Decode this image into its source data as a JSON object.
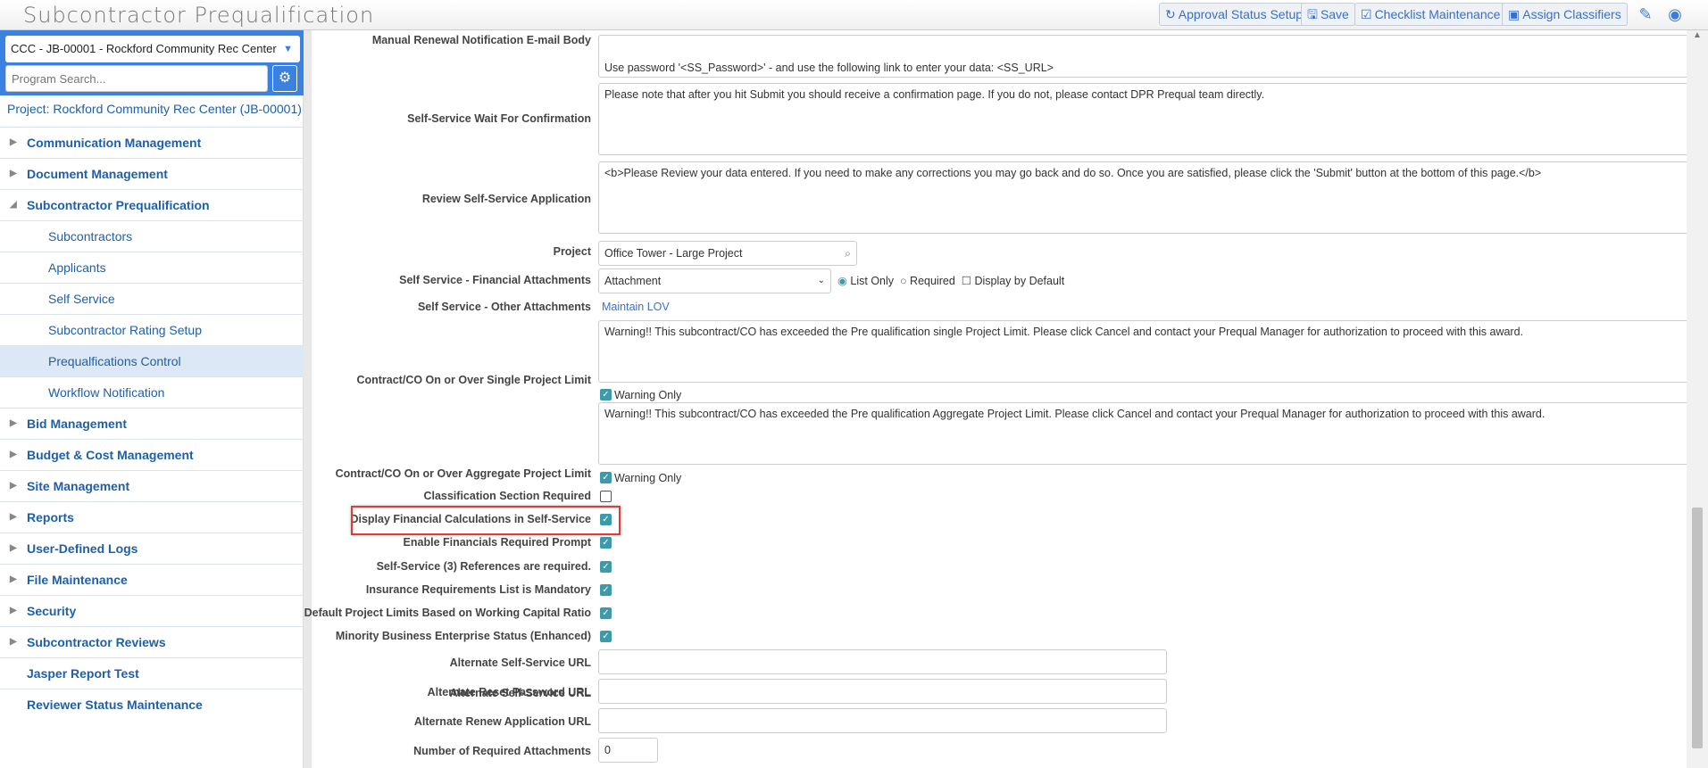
{
  "header": {
    "title": "Subcontractor Prequalification",
    "buttons": {
      "approval": "Approval Status Setup",
      "save": "Save",
      "checklist": "Checklist Maintenance",
      "classifiers": "Assign Classifiers"
    }
  },
  "sidebar": {
    "project_select": "CCC - JB-00001 - Rockford Community Rec Center",
    "search_placeholder": "Program Search...",
    "project_link": "Project: Rockford Community Rec Center (JB-00001)",
    "items": [
      {
        "label": "Communication Management",
        "type": "top"
      },
      {
        "label": "Document Management",
        "type": "top"
      },
      {
        "label": "Subcontractor Prequalification",
        "type": "open"
      },
      {
        "label": "Subcontractors",
        "type": "sub"
      },
      {
        "label": "Applicants",
        "type": "sub"
      },
      {
        "label": "Self Service",
        "type": "sub"
      },
      {
        "label": "Subcontractor Rating Setup",
        "type": "sub"
      },
      {
        "label": "Prequalfications Control",
        "type": "sub",
        "selected": true
      },
      {
        "label": "Workflow Notification",
        "type": "sub"
      },
      {
        "label": "Bid Management",
        "type": "top"
      },
      {
        "label": "Budget & Cost Management",
        "type": "top"
      },
      {
        "label": "Site Management",
        "type": "top"
      },
      {
        "label": "Reports",
        "type": "top"
      },
      {
        "label": "User-Defined Logs",
        "type": "top"
      },
      {
        "label": "File Maintenance",
        "type": "top"
      },
      {
        "label": "Security",
        "type": "top"
      },
      {
        "label": "Subcontractor Reviews",
        "type": "top"
      },
      {
        "label": "Jasper Report Test",
        "type": "plain"
      },
      {
        "label": "Reviewer Status Maintenance",
        "type": "plain"
      }
    ]
  },
  "form": {
    "manual_renewal": {
      "label": "Manual Renewal Notification E-mail Body",
      "value": "Use password '<SS_Password>' - and use the following link to enter your data: <SS_URL>"
    },
    "wait": {
      "label": "Self-Service Wait For Confirmation",
      "value": "Please note that after you hit Submit you should receive a confirmation page.  If you do not, please contact DPR Prequal team directly."
    },
    "review": {
      "label": "Review Self-Service Application",
      "value": "<b>Please Review your data entered.  If you need to make any corrections you may go back and do so.  Once you are satisfied, please click the 'Submit' button at the bottom of this page.</b>"
    },
    "project": {
      "label": "Project",
      "value": "Office Tower - Large Project"
    },
    "fin_attach": {
      "label": "Self Service - Financial Attachments",
      "value": "Attachment",
      "list_only": "List Only",
      "required": "Required",
      "display_default": "Display by Default"
    },
    "other_attach": {
      "label": "Self Service - Other Attachments",
      "link": "Maintain LOV"
    },
    "single_limit": {
      "label": "Contract/CO On or Over Single Project Limit",
      "value": "Warning!! This subcontract/CO has exceeded the Pre qualification single Project Limit. Please click Cancel and contact your Prequal Manager for authorization to proceed with this award.",
      "warning": "Warning Only"
    },
    "aggregate_limit": {
      "label": "Contract/CO On or Over Aggregate Project Limit",
      "value": "Warning!! This subcontract/CO has exceeded the Pre qualification Aggregate Project Limit. Please click Cancel and contact your Prequal Manager for authorization to proceed with this award.",
      "warning": "Warning Only"
    },
    "checks": [
      {
        "label": "Classification Section Required",
        "checked": false
      },
      {
        "label": "Display Financial Calculations in Self-Service",
        "checked": true
      },
      {
        "label": "Enable Financials Required Prompt",
        "checked": true
      },
      {
        "label": "Self-Service (3) References are required.",
        "checked": true
      },
      {
        "label": "Insurance Requirements List is Mandatory",
        "checked": true
      },
      {
        "label": "Default Project Limits Based on Working Capital Ratio",
        "checked": true
      },
      {
        "label": "Minority Business Enterprise Status (Enhanced)",
        "checked": true
      }
    ],
    "alt_ss_url": {
      "label": "Alternate Self-Service URL",
      "value": ""
    },
    "alt_reset_url": {
      "label": "Alternate Reset Password URL",
      "value": ""
    },
    "alt_renew_url": {
      "label": "Alternate Renew Application URL",
      "value": ""
    },
    "num_attach": {
      "label": "Number of Required Attachments",
      "value": "0"
    }
  }
}
